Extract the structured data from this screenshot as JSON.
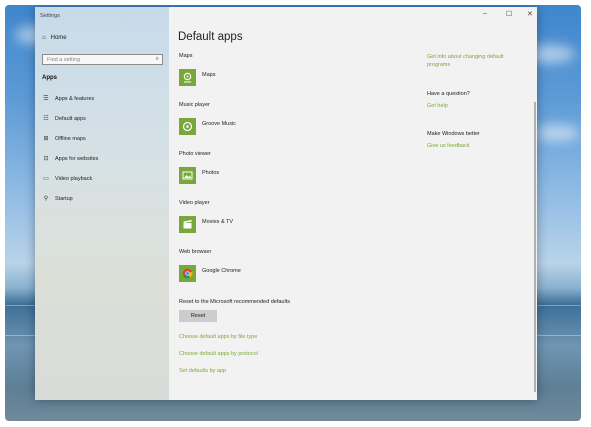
{
  "sidebar": {
    "window_title": "Settings",
    "home_label": "Home",
    "search_placeholder": "Find a setting",
    "section_title": "Apps",
    "items": [
      {
        "label": "Apps & features",
        "icon": "list-icon"
      },
      {
        "label": "Default apps",
        "icon": "default-apps-icon"
      },
      {
        "label": "Offline maps",
        "icon": "map-icon"
      },
      {
        "label": "Apps for websites",
        "icon": "web-icon"
      },
      {
        "label": "Video playback",
        "icon": "video-icon"
      },
      {
        "label": "Startup",
        "icon": "startup-icon"
      }
    ]
  },
  "main": {
    "title": "Default apps",
    "categories": [
      {
        "category": "Maps",
        "app": "Maps",
        "icon": "maps-icon"
      },
      {
        "category": "Music player",
        "app": "Groove Music",
        "icon": "groove-icon"
      },
      {
        "category": "Photo viewer",
        "app": "Photos",
        "icon": "photos-icon"
      },
      {
        "category": "Video player",
        "app": "Movies & TV",
        "icon": "movies-icon"
      },
      {
        "category": "Web browser",
        "app": "Google Chrome",
        "icon": "chrome-icon"
      }
    ],
    "reset_label": "Reset to the Microsoft recommended defaults",
    "reset_button": "Reset",
    "links": [
      "Choose default apps by file type",
      "Choose default apps by protocol",
      "Set defaults by app"
    ]
  },
  "right": {
    "info_link": "Get info about changing default programs",
    "question_title": "Have a question?",
    "help_link": "Get help",
    "better_title": "Make Windows better",
    "feedback_link": "Give us feedback"
  },
  "colors": {
    "accent": "#7ea833",
    "tile": "#79a73c"
  }
}
